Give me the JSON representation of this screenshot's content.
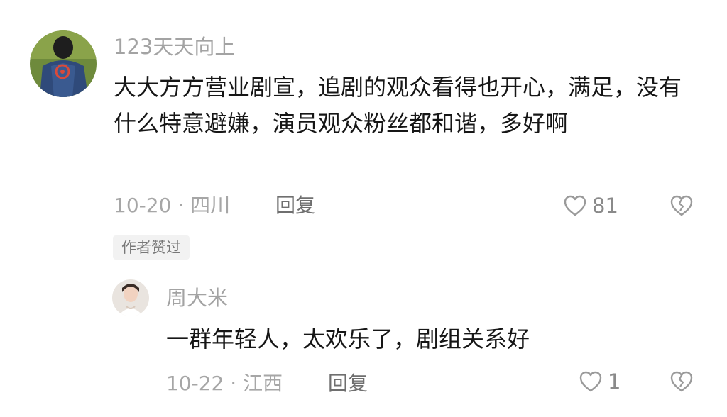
{
  "comments": [
    {
      "username": "123天天向上",
      "text": "大大方方营业剧宣，追剧的观众看得也开心，满足，没有什么特意避嫌，演员观众粉丝都和谐，多好啊",
      "date_location": "10-20 · 四川",
      "reply_label": "回复",
      "like_count": "81",
      "badge": "作者赞过"
    },
    {
      "username": "周大米",
      "text": "一群年轻人，太欢乐了，剧组关系好",
      "date_location": "10-22 · 江西",
      "reply_label": "回复",
      "like_count": "1"
    }
  ],
  "colors": {
    "username": "#a3a3a3",
    "content": "#161616",
    "meta": "#a6a6a6",
    "badge_bg": "#f2f2f2"
  },
  "icons": {
    "like": "heart-outline-icon",
    "dislike": "broken-heart-icon"
  }
}
